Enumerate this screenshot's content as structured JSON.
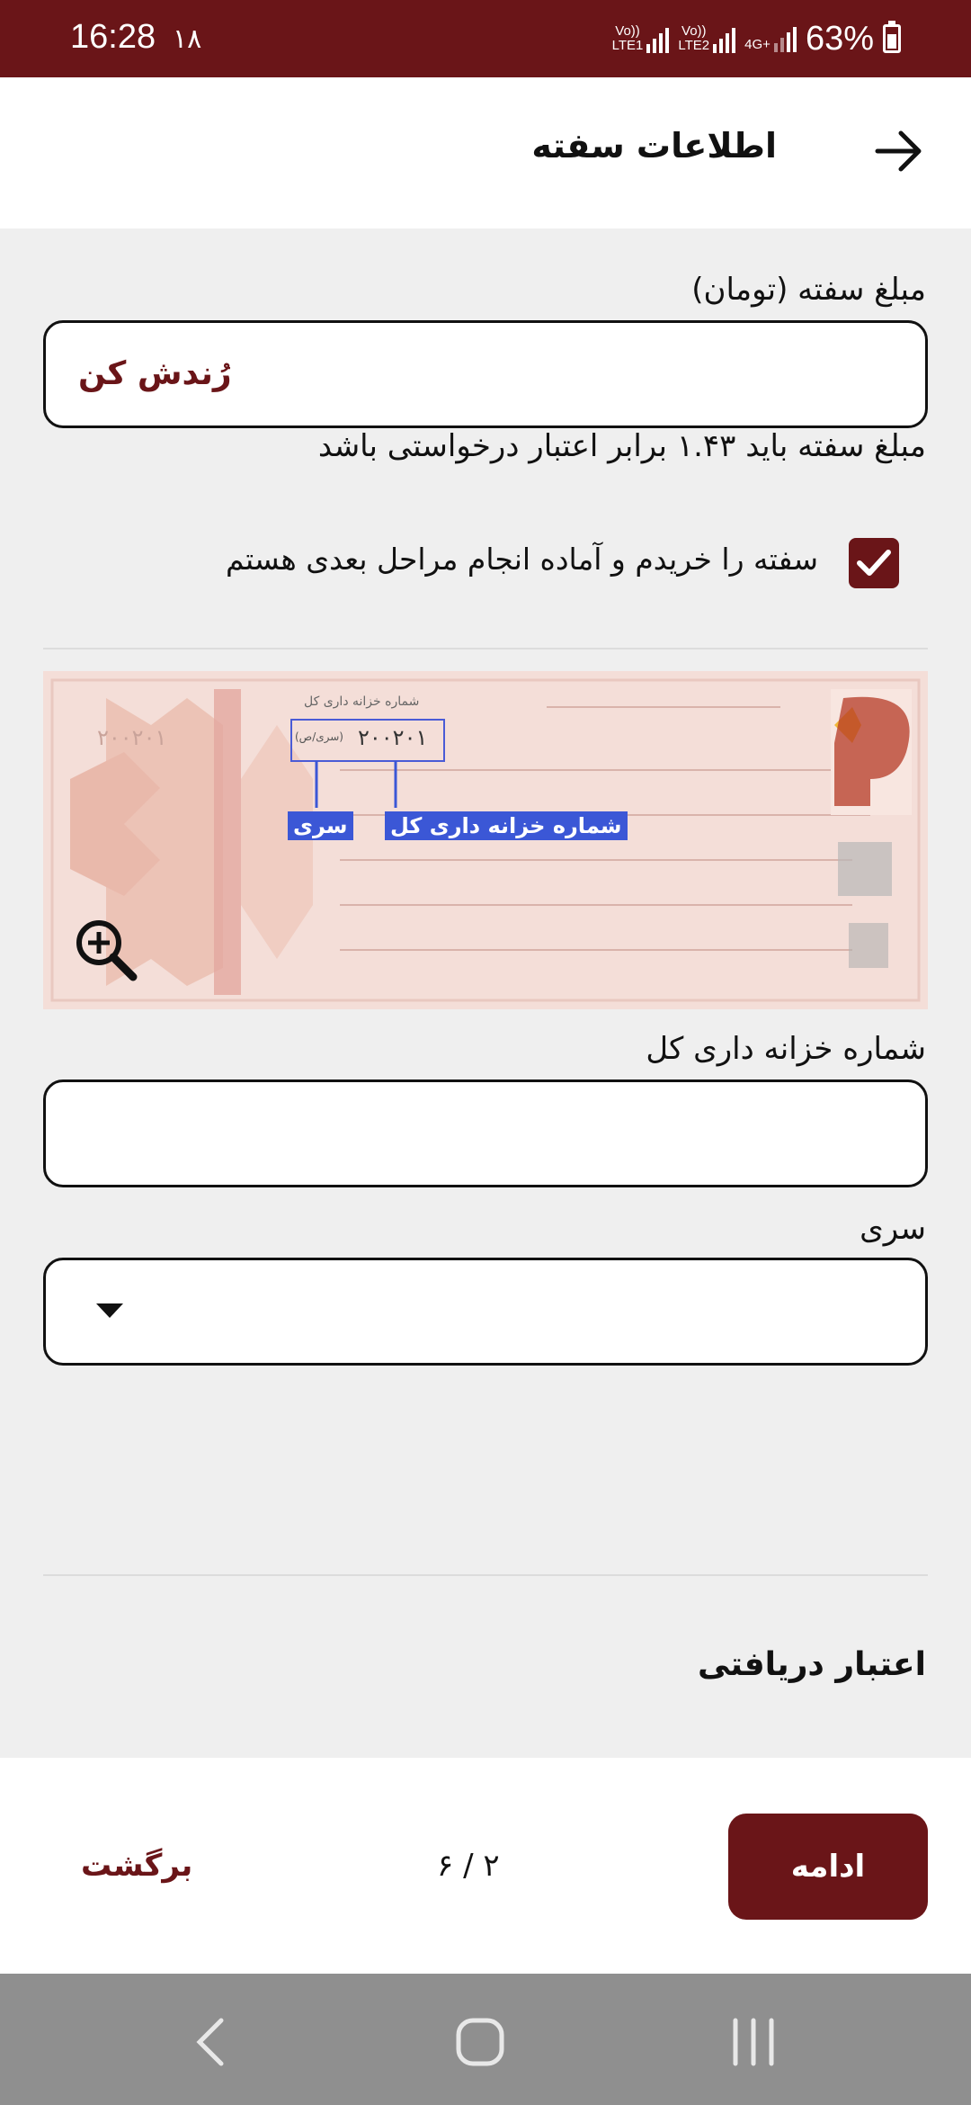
{
  "status_bar": {
    "time": "16:28",
    "notification": "۱۸",
    "sim1_label": "Vo))\nLTE1",
    "sim2_label": "Vo))\nLTE2",
    "network": "4G+",
    "battery": "63%"
  },
  "header": {
    "title": "اطلاعات سفته"
  },
  "amount": {
    "label": "مبلغ سفته (تومان)",
    "round_button": "رُندش کن",
    "hint": "مبلغ سفته باید ۱.۴۳ برابر اعتبار درخواستی باشد"
  },
  "confirm": {
    "checked": true,
    "label": "سفته را خریدم و آماده انجام مراحل بعدی هستم"
  },
  "sample_image": {
    "callout_series": "سری",
    "callout_treasury": "شماره خزانه داری کل",
    "serial_printed": "۲۰۰۲۰۱",
    "serial_left": "۲۰۰۲۰۱",
    "mini_title": "شماره خزانه داری کل",
    "mini_series": "(سری/ص)"
  },
  "treasury": {
    "label": "شماره خزانه داری کل",
    "value": ""
  },
  "series": {
    "label": "سری",
    "selected": ""
  },
  "credit": {
    "label": "اعتبار دریافتی"
  },
  "footer": {
    "continue": "ادامه",
    "step": "۲ / ۶",
    "back": "برگشت"
  },
  "colors": {
    "brand": "#6a1518",
    "callout": "#3b57d6"
  }
}
